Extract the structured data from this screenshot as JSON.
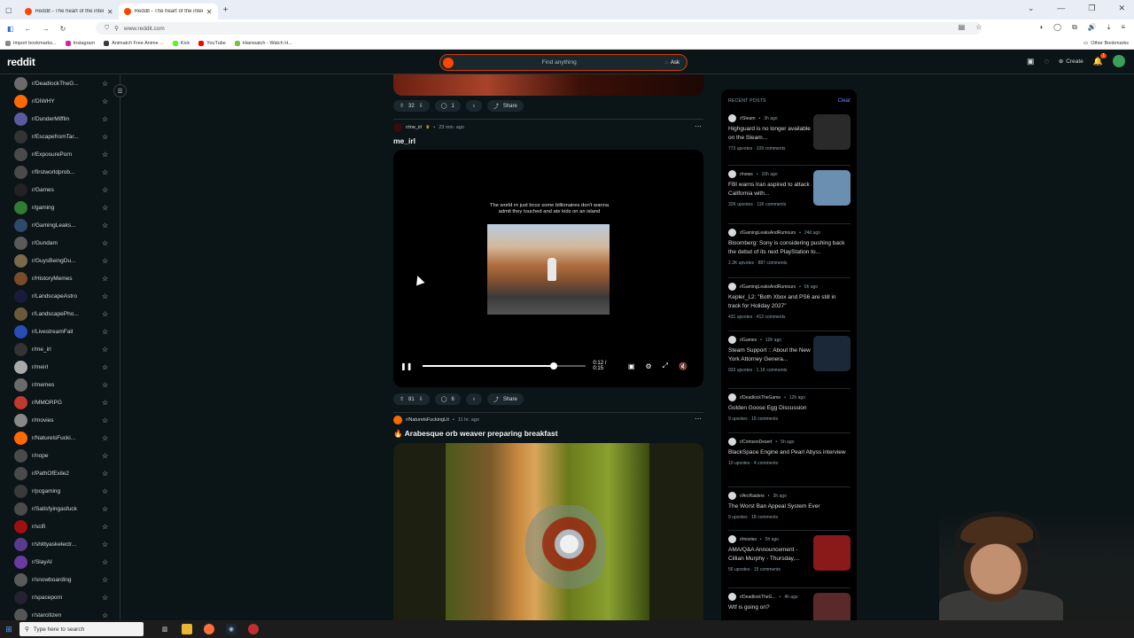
{
  "browser": {
    "tabs": [
      {
        "title": "Reddit - The heart of the intern",
        "active": false
      },
      {
        "title": "Reddit - The heart of the intern",
        "active": true
      }
    ],
    "new_tab": "+",
    "url": "www.reddit.com",
    "bookmarks": [
      {
        "label": "Import bookmarks...",
        "color": "#888888"
      },
      {
        "label": "Instagram",
        "color": "#d6249f"
      },
      {
        "label": "Animatch Free Anime ...",
        "color": "#3a3a3a"
      },
      {
        "label": "Kick",
        "color": "#53fc18"
      },
      {
        "label": "YouTube",
        "color": "#ff0000"
      },
      {
        "label": "Hianwatch - Watch H...",
        "color": "#7bc043"
      }
    ],
    "other_bookmarks": "Other Bookmarks"
  },
  "header": {
    "logo": "reddit",
    "search_placeholder": "Find anything",
    "ask_label": "Ask",
    "create_label": "Create",
    "notif_count": "1"
  },
  "sidebar": {
    "items": [
      {
        "name": "r/DeadlockTheG...",
        "color": "#6b6b6b"
      },
      {
        "name": "r/DIWHY",
        "color": "#ff6a00"
      },
      {
        "name": "r/DunderMifflin",
        "color": "#5a5aa0"
      },
      {
        "name": "r/EscapefromTar...",
        "color": "#333333"
      },
      {
        "name": "r/ExposurePorn",
        "color": "#4a4a4a"
      },
      {
        "name": "r/firstworldprob...",
        "color": "#4a4a4a"
      },
      {
        "name": "r/Games",
        "color": "#222222"
      },
      {
        "name": "r/gaming",
        "color": "#2e7d32"
      },
      {
        "name": "r/GamingLeaks...",
        "color": "#2d4a6b"
      },
      {
        "name": "r/Gundam",
        "color": "#5a5a5a"
      },
      {
        "name": "r/GuysBeingDu...",
        "color": "#7a6a4a"
      },
      {
        "name": "r/HistoryMemes",
        "color": "#7a4a2a"
      },
      {
        "name": "r/LandscapeAstro",
        "color": "#1a1a3a"
      },
      {
        "name": "r/LandscapePho...",
        "color": "#6a5a3a"
      },
      {
        "name": "r/LivestreamFail",
        "color": "#2b4bb5"
      },
      {
        "name": "r/me_irl",
        "color": "#333333"
      },
      {
        "name": "r/meirl",
        "color": "#aaaaaa"
      },
      {
        "name": "r/memes",
        "color": "#6a6a6a"
      },
      {
        "name": "r/MMORPG",
        "color": "#c0392b"
      },
      {
        "name": "r/movies",
        "color": "#888888"
      },
      {
        "name": "r/NaturelsFucki...",
        "color": "#ff6a00"
      },
      {
        "name": "r/nope",
        "color": "#4a4a4a"
      },
      {
        "name": "r/PathOfExile2",
        "color": "#4a4a4a"
      },
      {
        "name": "r/pcgaming",
        "color": "#3a3a3a"
      },
      {
        "name": "r/Satisfyingasfuck",
        "color": "#4a4a4a"
      },
      {
        "name": "r/scifi",
        "color": "#a01010"
      },
      {
        "name": "r/shittyaskelectr...",
        "color": "#5a3a8a"
      },
      {
        "name": "r/SlayAI",
        "color": "#6a3aa0"
      },
      {
        "name": "r/snowboarding",
        "color": "#5a5a5a"
      },
      {
        "name": "r/spaceporn",
        "color": "#222233"
      },
      {
        "name": "r/starcitizen",
        "color": "#555555"
      }
    ]
  },
  "feed": {
    "prev_post": {
      "votes": "32",
      "comments": "1",
      "share": "Share"
    },
    "post1": {
      "subreddit": "r/me_irl",
      "time": "23 min. ago",
      "title": "me_irl",
      "caption": "The world rn just bcoz some billionaires don't wanna admit they touched and ate kids on an island",
      "time_display": "0:12 / 0:15",
      "progress": 0.8,
      "votes": "81",
      "comments": "6",
      "share": "Share"
    },
    "post2": {
      "subreddit": "r/NaturelsFuckingLit",
      "time": "11 hr. ago",
      "title": "Arabesque orb weaver preparing breakfast"
    }
  },
  "recent": {
    "heading": "RECENT POSTS",
    "clear": "Clear",
    "items": [
      {
        "sub": "r/Steam",
        "time": "3h ago",
        "title": "Highguard is no longer available on the Steam...",
        "stats": "773 upvotes · 109 comments",
        "thumb": "#2a2a2a"
      },
      {
        "sub": "r/news",
        "time": "10h ago",
        "title": "FBI warns Iran aspired to attack California with...",
        "stats": "32K upvotes · 11K comments",
        "thumb": "#6a8fb0"
      },
      {
        "sub": "r/GamingLeaksAndRumours",
        "time": "24d ago",
        "title": "Bloomberg: Sony is considering pushing back the debut of its next PlayStation to...",
        "stats": "2.3K upvotes · 887 comments",
        "thumb": ""
      },
      {
        "sub": "r/GamingLeaksAndRumours",
        "time": "6h ago",
        "title": "Kepler_L2: \"Both Xbox and PS6 are still in track for Holiday 2027\"",
        "stats": "431 upvotes · 412 comments",
        "thumb": ""
      },
      {
        "sub": "r/Games",
        "time": "10h ago",
        "title": "Steam Support :: About the New York Attorney Genera...",
        "stats": "933 upvotes · 1.1K comments",
        "thumb": "#1b2838"
      },
      {
        "sub": "r/DeadlockTheGame",
        "time": "12h ago",
        "title": "Golden Goose Egg Discussion",
        "stats": "9 upvotes · 16 comments",
        "thumb": ""
      },
      {
        "sub": "r/CrimsonDesert",
        "time": "5h ago",
        "title": "BlackSpace Engine and Pearl Abyss interview",
        "stats": "10 upvotes · 4 comments",
        "thumb": ""
      },
      {
        "sub": "r/ArcRaiders",
        "time": "3h ago",
        "title": "The Worst Ban Appeal System Ever",
        "stats": "9 upvotes · 18 comments",
        "thumb": ""
      },
      {
        "sub": "r/movies",
        "time": "5h ago",
        "title": "AMA/Q&A Announcement - Cillian Murphy - Thursday,...",
        "stats": "56 upvotes · 15 comments",
        "thumb": "#8a1a1a"
      },
      {
        "sub": "r/DeadlockTheG...",
        "time": "4h ago",
        "title": "Wtf is going on?",
        "stats": "",
        "thumb": "#5a2a2a"
      }
    ]
  },
  "taskbar": {
    "search_placeholder": "Type here to search"
  }
}
